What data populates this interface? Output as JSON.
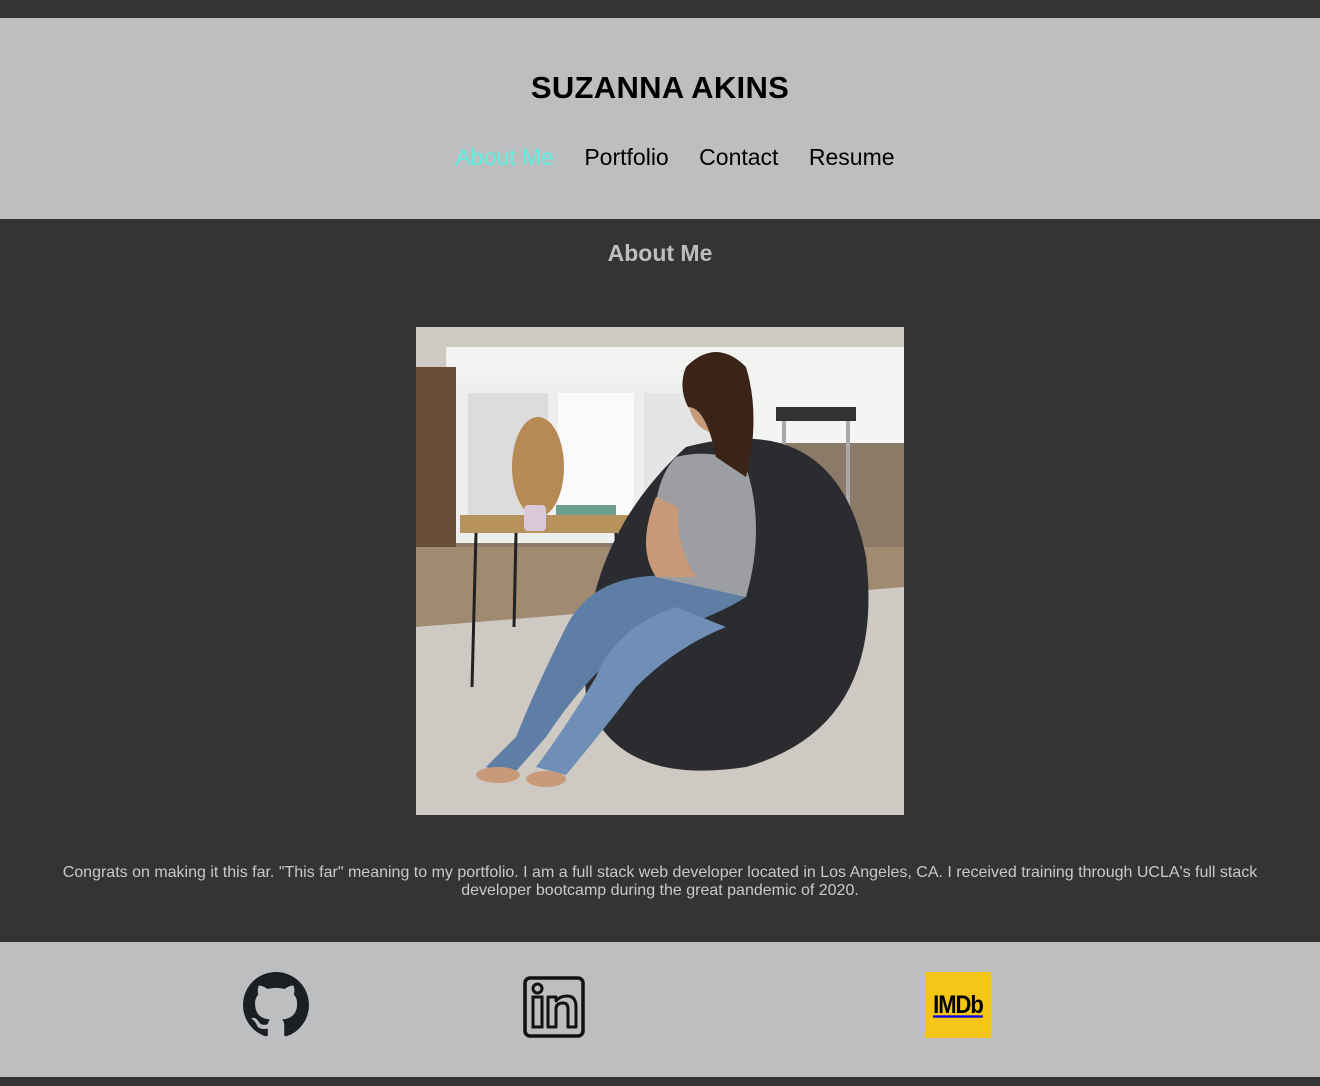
{
  "header": {
    "title": "SUZANNA AKINS",
    "nav": [
      {
        "label": "About Me",
        "active": true
      },
      {
        "label": "Portfolio",
        "active": false
      },
      {
        "label": "Contact",
        "active": false
      },
      {
        "label": "Resume",
        "active": false
      }
    ]
  },
  "main": {
    "section_title": "About Me",
    "bio": "Congrats on making it this far. \"This far\" meaning to my portfolio. I am a full stack web developer located in Los Angeles, CA. I received training through UCLA's full stack developer bootcamp during the great pandemic of 2020."
  },
  "footer": {
    "links": [
      {
        "icon": "github-icon"
      },
      {
        "icon": "linkedin-icon"
      },
      {
        "icon": "imdb-icon",
        "label": "IMDb"
      }
    ]
  },
  "colors": {
    "page_bg": "#343434",
    "bar_bg": "#bdbec0",
    "active_nav": "#5ef0e3",
    "imdb_yellow": "#f5c518"
  }
}
